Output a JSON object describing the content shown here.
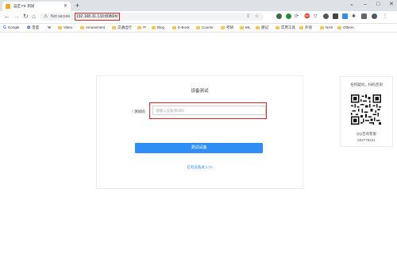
{
  "browser": {
    "tab_title": "設定 FE 測試",
    "tab_close": "✕",
    "new_tab": "+",
    "window_min": "–",
    "window_max": "□",
    "window_close": "✕",
    "window_restore": "⌄",
    "security_label": "Not secure",
    "url": "192.168.31.133:8080/#/",
    "bookmarks": [
      {
        "label": "Google",
        "type": "google"
      },
      {
        "label": "百度",
        "type": "paw"
      },
      {
        "label": "W",
        "type": "wiki"
      },
      {
        "label": "Video",
        "type": "folder"
      },
      {
        "label": "Amusement",
        "type": "folder"
      },
      {
        "label": "交通出行",
        "type": "folder"
      },
      {
        "label": "IT",
        "type": "folder"
      },
      {
        "label": "Blog",
        "type": "folder"
      },
      {
        "label": "E-Book",
        "type": "folder"
      },
      {
        "label": "Course",
        "type": "folder"
      },
      {
        "label": "考研",
        "type": "folder"
      },
      {
        "label": "ML",
        "type": "folder"
      },
      {
        "label": "随记",
        "type": "folder"
      },
      {
        "label": "实用工具",
        "type": "folder"
      },
      {
        "label": "外语",
        "type": "folder"
      },
      {
        "label": "NAS",
        "type": "folder"
      },
      {
        "label": "Others",
        "type": "folder"
      }
    ]
  },
  "page": {
    "card_title": "设备测试",
    "field_label": "测试码:",
    "required_mark": "*",
    "field_placeholder": "请输入设备测试码",
    "test_button": "测试设备",
    "link_text": "已有设备进入>>"
  },
  "side": {
    "title": "任何疑问，扫码咨询",
    "qq_label": "QQ咨询客服",
    "qq_number": "602778231"
  },
  "colors": {
    "accent": "#2f8df6",
    "highlight": "#d9232d"
  }
}
